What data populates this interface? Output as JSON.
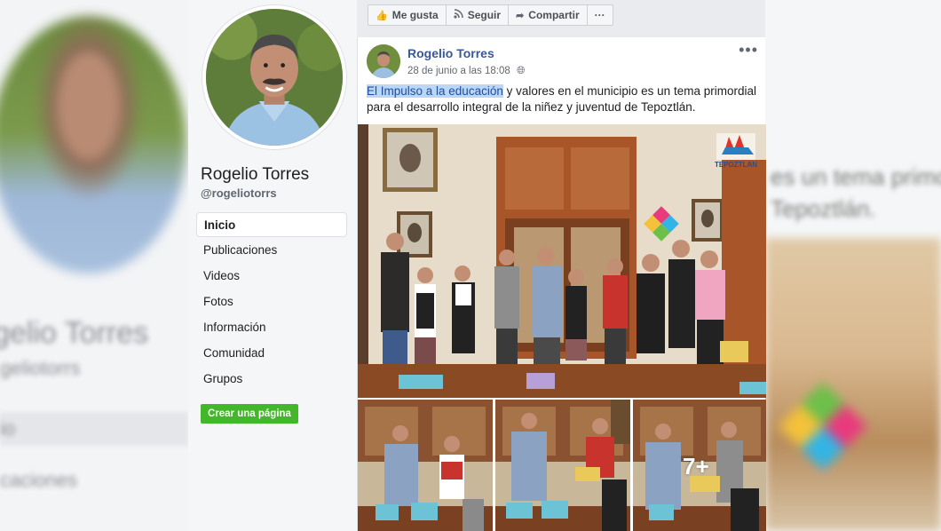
{
  "page": {
    "name": "Rogelio Torres",
    "handle": "@rogeliotorrs"
  },
  "nav": {
    "items": [
      {
        "label": "Inicio",
        "active": true
      },
      {
        "label": "Publicaciones",
        "active": false
      },
      {
        "label": "Videos",
        "active": false
      },
      {
        "label": "Fotos",
        "active": false
      },
      {
        "label": "Información",
        "active": false
      },
      {
        "label": "Comunidad",
        "active": false
      },
      {
        "label": "Grupos",
        "active": false
      }
    ],
    "create_page_label": "Crear una página"
  },
  "actions": {
    "like": "Me gusta",
    "follow": "Seguir",
    "share": "Compartir",
    "more": "···"
  },
  "post": {
    "author": "Rogelio Torres",
    "date": "28 de junio a las 18:08",
    "privacy_icon": "globe-icon",
    "options": "•••",
    "text_highlighted": "El Impulso a la educación",
    "text_rest": " y valores en el municipio es un tema primordial para el desarrollo integral de la niñez y juventud de Tepoztlán.",
    "photo_logo_text": "TEPOZTLAN",
    "extra_photos_label": "7+"
  },
  "background": {
    "left_blur_1": "gelio Torres",
    "left_blur_2": "geliotorrs",
    "left_blur_3": "io",
    "left_blur_4": "caciones",
    "right_blur_1": "es un tema primor",
    "right_blur_2": "Tepoztlán."
  },
  "colors": {
    "link_blue": "#385898",
    "create_green": "#42b72a",
    "highlight": "#bcd6f5",
    "fb_background": "#e9ebee"
  }
}
